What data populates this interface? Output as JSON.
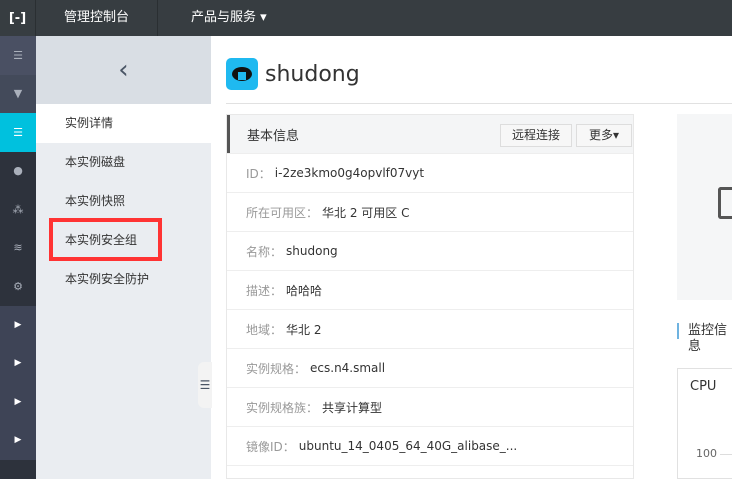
{
  "topbar": {
    "logo": "[-]",
    "console": "管理控制台",
    "products": "产品与服务 ▾"
  },
  "sidebar": {
    "back": "‹",
    "items": [
      {
        "label": "实例详情"
      },
      {
        "label": "本实例磁盘"
      },
      {
        "label": "本实例快照"
      },
      {
        "label": "本实例安全组"
      },
      {
        "label": "本实例安全防护"
      }
    ]
  },
  "header": {
    "title": "shudong"
  },
  "basic_info": {
    "title": "基本信息",
    "remote_btn": "远程连接",
    "more_btn": "更多▾",
    "rows": [
      {
        "k": "ID：",
        "v": "i-2ze3kmo0g4opvlf07vyt"
      },
      {
        "k": "所在可用区：",
        "v": "华北 2 可用区 C"
      },
      {
        "k": "名称：",
        "v": "shudong"
      },
      {
        "k": "描述：",
        "v": "哈哈哈"
      },
      {
        "k": "地域：",
        "v": "华北 2"
      },
      {
        "k": "实例规格：",
        "v": "ecs.n4.small"
      },
      {
        "k": "实例规格族：",
        "v": "共享计算型"
      },
      {
        "k": "镜像ID：",
        "v": "ubuntu_14_0405_64_40G_alibase_..."
      }
    ]
  },
  "monitor": {
    "title": "监控信息",
    "cpu": "CPU",
    "tick": "100"
  },
  "colors": {
    "accent": "#00c1de",
    "highlight": "#ff3333"
  }
}
